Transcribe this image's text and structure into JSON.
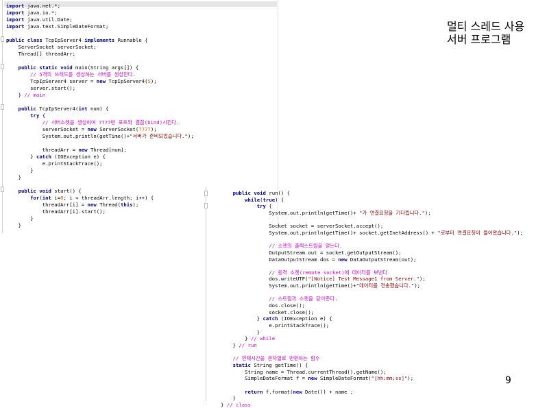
{
  "slide": {
    "title_line1": "멀티 스레드 사용",
    "title_line2": "서버 프로그램",
    "page_number": "9"
  },
  "code_left": [
    [
      [
        "kw",
        "import"
      ],
      [
        "p",
        " java.net.*;"
      ]
    ],
    [
      [
        "kw",
        "import"
      ],
      [
        "p",
        " java.io.*;"
      ]
    ],
    [
      [
        "kw",
        "import"
      ],
      [
        "p",
        " java.util.Date;"
      ]
    ],
    [
      [
        "kw",
        "import"
      ],
      [
        "p",
        " java.text.SimpleDateFormat;"
      ]
    ],
    [],
    [
      [
        "kw",
        "public"
      ],
      [
        "p",
        " "
      ],
      [
        "kw",
        "class"
      ],
      [
        "p",
        " TcpIpServer4 "
      ],
      [
        "kw",
        "implements"
      ],
      [
        "p",
        " Runnable {"
      ]
    ],
    [
      [
        "p",
        "    ServerSocket serverSocket;"
      ]
    ],
    [
      [
        "p",
        "    Thread[] threadArr;"
      ]
    ],
    [],
    [
      [
        "p",
        "    "
      ],
      [
        "kw",
        "public static void"
      ],
      [
        "p",
        " main(String args[]) {"
      ]
    ],
    [
      [
        "p",
        "        "
      ],
      [
        "cm",
        "// 5개의 쓰레드를 생성하는 서버를 생성한다."
      ]
    ],
    [
      [
        "p",
        "        TcpIpServer4 server = "
      ],
      [
        "kw",
        "new"
      ],
      [
        "p",
        " TcpIpServer4("
      ],
      [
        "num",
        "5"
      ],
      [
        "p",
        ");"
      ]
    ],
    [
      [
        "p",
        "        server.start();"
      ]
    ],
    [
      [
        "p",
        "    } "
      ],
      [
        "cm",
        "// main"
      ]
    ],
    [],
    [
      [
        "p",
        "    "
      ],
      [
        "kw",
        "public"
      ],
      [
        "p",
        " TcpIpServer4("
      ],
      [
        "kw",
        "int"
      ],
      [
        "p",
        " num) {"
      ]
    ],
    [
      [
        "p",
        "        "
      ],
      [
        "kw",
        "try"
      ],
      [
        "p",
        " {"
      ]
    ],
    [
      [
        "p",
        "            "
      ],
      [
        "cm",
        "// 서버소켓을 생성하여 7777번 포트와 결합(bind)시킨다."
      ]
    ],
    [
      [
        "p",
        "            serverSocket = "
      ],
      [
        "kw",
        "new"
      ],
      [
        "p",
        " ServerSocket("
      ],
      [
        "num",
        "7777"
      ],
      [
        "p",
        ");"
      ]
    ],
    [
      [
        "p",
        "            System.out.println(getTime()+"
      ],
      [
        "str",
        "\"서버가 준비되었습니다.\""
      ],
      [
        "p",
        ");"
      ]
    ],
    [],
    [
      [
        "p",
        "            threadArr = "
      ],
      [
        "kw",
        "new"
      ],
      [
        "p",
        " Thread[num];"
      ]
    ],
    [
      [
        "p",
        "        } "
      ],
      [
        "kw",
        "catch"
      ],
      [
        "p",
        " (IOException e) {"
      ]
    ],
    [
      [
        "p",
        "            e.printStackTrace();"
      ]
    ],
    [
      [
        "p",
        "        }"
      ]
    ],
    [
      [
        "p",
        "    }"
      ]
    ],
    [],
    [
      [
        "p",
        "    "
      ],
      [
        "kw",
        "public void"
      ],
      [
        "p",
        " start() {"
      ]
    ],
    [
      [
        "p",
        "        "
      ],
      [
        "kw",
        "for"
      ],
      [
        "p",
        "("
      ],
      [
        "kw",
        "int"
      ],
      [
        "p",
        " i="
      ],
      [
        "num",
        "0"
      ],
      [
        "p",
        "; i < threadArr.length; i++) {"
      ]
    ],
    [
      [
        "p",
        "            threadArr[i] = "
      ],
      [
        "kw",
        "new"
      ],
      [
        "p",
        " Thread("
      ],
      [
        "kw",
        "this"
      ],
      [
        "p",
        ");"
      ]
    ],
    [
      [
        "p",
        "            threadArr[i].start();"
      ]
    ],
    [
      [
        "p",
        "        }"
      ]
    ],
    [
      [
        "p",
        "    }"
      ]
    ]
  ],
  "code_right": [
    [
      [
        "p",
        "    "
      ],
      [
        "kw",
        "public void"
      ],
      [
        "p",
        " run() {"
      ]
    ],
    [
      [
        "p",
        "        "
      ],
      [
        "kw",
        "while"
      ],
      [
        "p",
        "("
      ],
      [
        "kw",
        "true"
      ],
      [
        "p",
        ") {"
      ]
    ],
    [
      [
        "p",
        "            "
      ],
      [
        "kw",
        "try"
      ],
      [
        "p",
        " {"
      ]
    ],
    [
      [
        "p",
        "                System.out.println(getTime()+ "
      ],
      [
        "str",
        "\"가 연결요청을 기다립니다.\""
      ],
      [
        "p",
        ");"
      ]
    ],
    [],
    [
      [
        "p",
        "                Socket socket = serverSocket.accept();"
      ]
    ],
    [
      [
        "p",
        "                System.out.println(getTime()+ socket.getInetAddress() + "
      ],
      [
        "str",
        "\"로부터 연결요청이 들어왔습니다.\""
      ],
      [
        "p",
        ");"
      ]
    ],
    [],
    [
      [
        "p",
        "                "
      ],
      [
        "cm",
        "// 소켓의 출력스트림을 얻는다."
      ]
    ],
    [
      [
        "p",
        "                OutputStream out = socket.getOutputStream();"
      ]
    ],
    [
      [
        "p",
        "                DataOutputStream dos = "
      ],
      [
        "kw",
        "new"
      ],
      [
        "p",
        " DataOutputStream(out);"
      ]
    ],
    [],
    [
      [
        "p",
        "                "
      ],
      [
        "cm",
        "// 원격 소켓(remote socket)에 데이터를 보낸다."
      ]
    ],
    [
      [
        "p",
        "                dos.writeUTF("
      ],
      [
        "str",
        "\"[Notice] Test Message1 from Server.\""
      ],
      [
        "p",
        ");"
      ]
    ],
    [
      [
        "p",
        "                System.out.println(getTime()+"
      ],
      [
        "str",
        "\"데이터를 전송했습니다.\""
      ],
      [
        "p",
        ");"
      ]
    ],
    [],
    [
      [
        "p",
        "                "
      ],
      [
        "cm",
        "// 스트림과 소켓을 닫아준다."
      ]
    ],
    [
      [
        "p",
        "                dos.close();"
      ]
    ],
    [
      [
        "p",
        "                socket.close();"
      ]
    ],
    [
      [
        "p",
        "            } "
      ],
      [
        "kw",
        "catch"
      ],
      [
        "p",
        " (IOException e) {"
      ]
    ],
    [
      [
        "p",
        "                e.printStackTrace();"
      ]
    ],
    [
      [
        "p",
        "            }"
      ]
    ],
    [
      [
        "p",
        "        } "
      ],
      [
        "cm",
        "// while"
      ]
    ],
    [
      [
        "p",
        "    } "
      ],
      [
        "cm",
        "// run"
      ]
    ],
    [],
    [
      [
        "p",
        "    "
      ],
      [
        "cm",
        "// 현재시간을 문자열로 반환하는 함수"
      ]
    ],
    [
      [
        "p",
        "    "
      ],
      [
        "kw",
        "static"
      ],
      [
        "p",
        " String getTime() {"
      ]
    ],
    [
      [
        "p",
        "        String name = Thread.currentThread().getName();"
      ]
    ],
    [
      [
        "p",
        "        SimpleDateFormat f = "
      ],
      [
        "kw",
        "new"
      ],
      [
        "p",
        " SimpleDateFormat("
      ],
      [
        "str",
        "\"[hh:mm:ss]\""
      ],
      [
        "p",
        ");"
      ]
    ],
    [],
    [
      [
        "p",
        "        "
      ],
      [
        "kw",
        "return"
      ],
      [
        "p",
        " f.format("
      ],
      [
        "kw",
        "new"
      ],
      [
        "p",
        " Date()) + name ;"
      ]
    ],
    [
      [
        "p",
        "    }"
      ]
    ],
    [
      [
        "p",
        "} "
      ],
      [
        "cm",
        "// class"
      ]
    ]
  ]
}
